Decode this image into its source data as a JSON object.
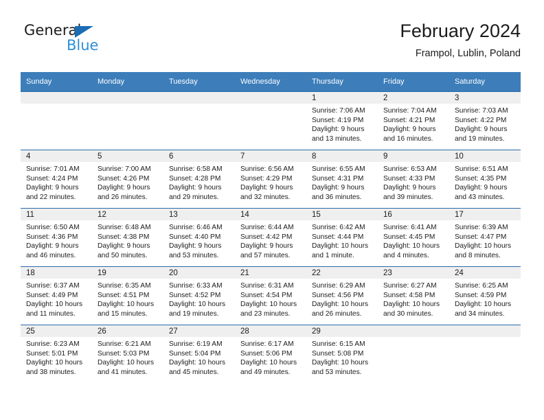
{
  "brand": {
    "name_part1": "General",
    "name_part2": "Blue",
    "accent_color": "#2e8fd8",
    "triangle_color": "#1a6cb5"
  },
  "header": {
    "month_title": "February 2024",
    "location": "Frampol, Lublin, Poland"
  },
  "theme": {
    "header_row_bg": "#3c7dba",
    "row_border": "#2a6aa8",
    "daynum_band_bg": "#efefef",
    "text": "#1b1b1b"
  },
  "weekday_headers": [
    "Sunday",
    "Monday",
    "Tuesday",
    "Wednesday",
    "Thursday",
    "Friday",
    "Saturday"
  ],
  "weeks": [
    [
      {
        "day": "",
        "sunrise": "",
        "sunset": "",
        "daylight_line1": "",
        "daylight_line2": ""
      },
      {
        "day": "",
        "sunrise": "",
        "sunset": "",
        "daylight_line1": "",
        "daylight_line2": ""
      },
      {
        "day": "",
        "sunrise": "",
        "sunset": "",
        "daylight_line1": "",
        "daylight_line2": ""
      },
      {
        "day": "",
        "sunrise": "",
        "sunset": "",
        "daylight_line1": "",
        "daylight_line2": ""
      },
      {
        "day": "1",
        "sunrise": "Sunrise: 7:06 AM",
        "sunset": "Sunset: 4:19 PM",
        "daylight_line1": "Daylight: 9 hours",
        "daylight_line2": "and 13 minutes."
      },
      {
        "day": "2",
        "sunrise": "Sunrise: 7:04 AM",
        "sunset": "Sunset: 4:21 PM",
        "daylight_line1": "Daylight: 9 hours",
        "daylight_line2": "and 16 minutes."
      },
      {
        "day": "3",
        "sunrise": "Sunrise: 7:03 AM",
        "sunset": "Sunset: 4:22 PM",
        "daylight_line1": "Daylight: 9 hours",
        "daylight_line2": "and 19 minutes."
      }
    ],
    [
      {
        "day": "4",
        "sunrise": "Sunrise: 7:01 AM",
        "sunset": "Sunset: 4:24 PM",
        "daylight_line1": "Daylight: 9 hours",
        "daylight_line2": "and 22 minutes."
      },
      {
        "day": "5",
        "sunrise": "Sunrise: 7:00 AM",
        "sunset": "Sunset: 4:26 PM",
        "daylight_line1": "Daylight: 9 hours",
        "daylight_line2": "and 26 minutes."
      },
      {
        "day": "6",
        "sunrise": "Sunrise: 6:58 AM",
        "sunset": "Sunset: 4:28 PM",
        "daylight_line1": "Daylight: 9 hours",
        "daylight_line2": "and 29 minutes."
      },
      {
        "day": "7",
        "sunrise": "Sunrise: 6:56 AM",
        "sunset": "Sunset: 4:29 PM",
        "daylight_line1": "Daylight: 9 hours",
        "daylight_line2": "and 32 minutes."
      },
      {
        "day": "8",
        "sunrise": "Sunrise: 6:55 AM",
        "sunset": "Sunset: 4:31 PM",
        "daylight_line1": "Daylight: 9 hours",
        "daylight_line2": "and 36 minutes."
      },
      {
        "day": "9",
        "sunrise": "Sunrise: 6:53 AM",
        "sunset": "Sunset: 4:33 PM",
        "daylight_line1": "Daylight: 9 hours",
        "daylight_line2": "and 39 minutes."
      },
      {
        "day": "10",
        "sunrise": "Sunrise: 6:51 AM",
        "sunset": "Sunset: 4:35 PM",
        "daylight_line1": "Daylight: 9 hours",
        "daylight_line2": "and 43 minutes."
      }
    ],
    [
      {
        "day": "11",
        "sunrise": "Sunrise: 6:50 AM",
        "sunset": "Sunset: 4:36 PM",
        "daylight_line1": "Daylight: 9 hours",
        "daylight_line2": "and 46 minutes."
      },
      {
        "day": "12",
        "sunrise": "Sunrise: 6:48 AM",
        "sunset": "Sunset: 4:38 PM",
        "daylight_line1": "Daylight: 9 hours",
        "daylight_line2": "and 50 minutes."
      },
      {
        "day": "13",
        "sunrise": "Sunrise: 6:46 AM",
        "sunset": "Sunset: 4:40 PM",
        "daylight_line1": "Daylight: 9 hours",
        "daylight_line2": "and 53 minutes."
      },
      {
        "day": "14",
        "sunrise": "Sunrise: 6:44 AM",
        "sunset": "Sunset: 4:42 PM",
        "daylight_line1": "Daylight: 9 hours",
        "daylight_line2": "and 57 minutes."
      },
      {
        "day": "15",
        "sunrise": "Sunrise: 6:42 AM",
        "sunset": "Sunset: 4:44 PM",
        "daylight_line1": "Daylight: 10 hours",
        "daylight_line2": "and 1 minute."
      },
      {
        "day": "16",
        "sunrise": "Sunrise: 6:41 AM",
        "sunset": "Sunset: 4:45 PM",
        "daylight_line1": "Daylight: 10 hours",
        "daylight_line2": "and 4 minutes."
      },
      {
        "day": "17",
        "sunrise": "Sunrise: 6:39 AM",
        "sunset": "Sunset: 4:47 PM",
        "daylight_line1": "Daylight: 10 hours",
        "daylight_line2": "and 8 minutes."
      }
    ],
    [
      {
        "day": "18",
        "sunrise": "Sunrise: 6:37 AM",
        "sunset": "Sunset: 4:49 PM",
        "daylight_line1": "Daylight: 10 hours",
        "daylight_line2": "and 11 minutes."
      },
      {
        "day": "19",
        "sunrise": "Sunrise: 6:35 AM",
        "sunset": "Sunset: 4:51 PM",
        "daylight_line1": "Daylight: 10 hours",
        "daylight_line2": "and 15 minutes."
      },
      {
        "day": "20",
        "sunrise": "Sunrise: 6:33 AM",
        "sunset": "Sunset: 4:52 PM",
        "daylight_line1": "Daylight: 10 hours",
        "daylight_line2": "and 19 minutes."
      },
      {
        "day": "21",
        "sunrise": "Sunrise: 6:31 AM",
        "sunset": "Sunset: 4:54 PM",
        "daylight_line1": "Daylight: 10 hours",
        "daylight_line2": "and 23 minutes."
      },
      {
        "day": "22",
        "sunrise": "Sunrise: 6:29 AM",
        "sunset": "Sunset: 4:56 PM",
        "daylight_line1": "Daylight: 10 hours",
        "daylight_line2": "and 26 minutes."
      },
      {
        "day": "23",
        "sunrise": "Sunrise: 6:27 AM",
        "sunset": "Sunset: 4:58 PM",
        "daylight_line1": "Daylight: 10 hours",
        "daylight_line2": "and 30 minutes."
      },
      {
        "day": "24",
        "sunrise": "Sunrise: 6:25 AM",
        "sunset": "Sunset: 4:59 PM",
        "daylight_line1": "Daylight: 10 hours",
        "daylight_line2": "and 34 minutes."
      }
    ],
    [
      {
        "day": "25",
        "sunrise": "Sunrise: 6:23 AM",
        "sunset": "Sunset: 5:01 PM",
        "daylight_line1": "Daylight: 10 hours",
        "daylight_line2": "and 38 minutes."
      },
      {
        "day": "26",
        "sunrise": "Sunrise: 6:21 AM",
        "sunset": "Sunset: 5:03 PM",
        "daylight_line1": "Daylight: 10 hours",
        "daylight_line2": "and 41 minutes."
      },
      {
        "day": "27",
        "sunrise": "Sunrise: 6:19 AM",
        "sunset": "Sunset: 5:04 PM",
        "daylight_line1": "Daylight: 10 hours",
        "daylight_line2": "and 45 minutes."
      },
      {
        "day": "28",
        "sunrise": "Sunrise: 6:17 AM",
        "sunset": "Sunset: 5:06 PM",
        "daylight_line1": "Daylight: 10 hours",
        "daylight_line2": "and 49 minutes."
      },
      {
        "day": "29",
        "sunrise": "Sunrise: 6:15 AM",
        "sunset": "Sunset: 5:08 PM",
        "daylight_line1": "Daylight: 10 hours",
        "daylight_line2": "and 53 minutes."
      },
      {
        "day": "",
        "sunrise": "",
        "sunset": "",
        "daylight_line1": "",
        "daylight_line2": ""
      },
      {
        "day": "",
        "sunrise": "",
        "sunset": "",
        "daylight_line1": "",
        "daylight_line2": ""
      }
    ]
  ]
}
